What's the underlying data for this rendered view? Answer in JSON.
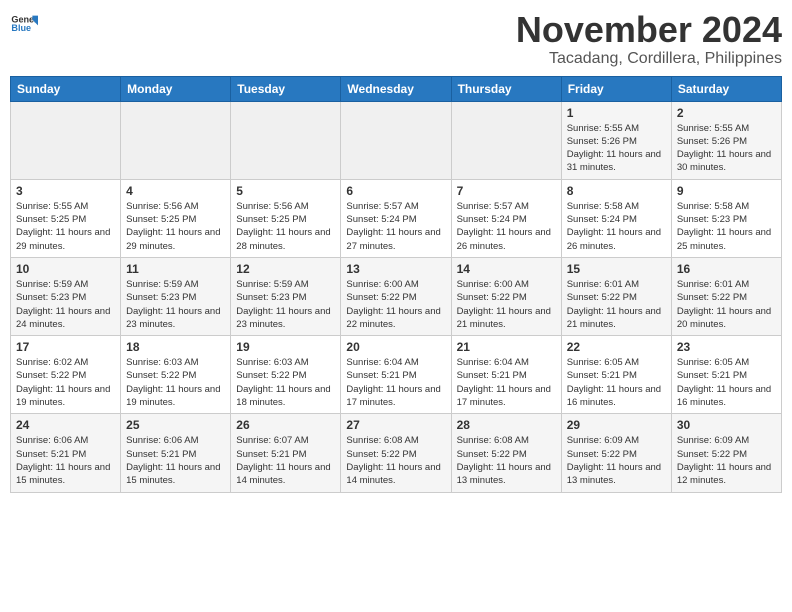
{
  "header": {
    "logo_line1": "General",
    "logo_line2": "Blue",
    "month": "November 2024",
    "location": "Tacadang, Cordillera, Philippines"
  },
  "weekdays": [
    "Sunday",
    "Monday",
    "Tuesday",
    "Wednesday",
    "Thursday",
    "Friday",
    "Saturday"
  ],
  "weeks": [
    [
      {
        "day": "",
        "info": ""
      },
      {
        "day": "",
        "info": ""
      },
      {
        "day": "",
        "info": ""
      },
      {
        "day": "",
        "info": ""
      },
      {
        "day": "",
        "info": ""
      },
      {
        "day": "1",
        "info": "Sunrise: 5:55 AM\nSunset: 5:26 PM\nDaylight: 11 hours and 31 minutes."
      },
      {
        "day": "2",
        "info": "Sunrise: 5:55 AM\nSunset: 5:26 PM\nDaylight: 11 hours and 30 minutes."
      }
    ],
    [
      {
        "day": "3",
        "info": "Sunrise: 5:55 AM\nSunset: 5:25 PM\nDaylight: 11 hours and 29 minutes."
      },
      {
        "day": "4",
        "info": "Sunrise: 5:56 AM\nSunset: 5:25 PM\nDaylight: 11 hours and 29 minutes."
      },
      {
        "day": "5",
        "info": "Sunrise: 5:56 AM\nSunset: 5:25 PM\nDaylight: 11 hours and 28 minutes."
      },
      {
        "day": "6",
        "info": "Sunrise: 5:57 AM\nSunset: 5:24 PM\nDaylight: 11 hours and 27 minutes."
      },
      {
        "day": "7",
        "info": "Sunrise: 5:57 AM\nSunset: 5:24 PM\nDaylight: 11 hours and 26 minutes."
      },
      {
        "day": "8",
        "info": "Sunrise: 5:58 AM\nSunset: 5:24 PM\nDaylight: 11 hours and 26 minutes."
      },
      {
        "day": "9",
        "info": "Sunrise: 5:58 AM\nSunset: 5:23 PM\nDaylight: 11 hours and 25 minutes."
      }
    ],
    [
      {
        "day": "10",
        "info": "Sunrise: 5:59 AM\nSunset: 5:23 PM\nDaylight: 11 hours and 24 minutes."
      },
      {
        "day": "11",
        "info": "Sunrise: 5:59 AM\nSunset: 5:23 PM\nDaylight: 11 hours and 23 minutes."
      },
      {
        "day": "12",
        "info": "Sunrise: 5:59 AM\nSunset: 5:23 PM\nDaylight: 11 hours and 23 minutes."
      },
      {
        "day": "13",
        "info": "Sunrise: 6:00 AM\nSunset: 5:22 PM\nDaylight: 11 hours and 22 minutes."
      },
      {
        "day": "14",
        "info": "Sunrise: 6:00 AM\nSunset: 5:22 PM\nDaylight: 11 hours and 21 minutes."
      },
      {
        "day": "15",
        "info": "Sunrise: 6:01 AM\nSunset: 5:22 PM\nDaylight: 11 hours and 21 minutes."
      },
      {
        "day": "16",
        "info": "Sunrise: 6:01 AM\nSunset: 5:22 PM\nDaylight: 11 hours and 20 minutes."
      }
    ],
    [
      {
        "day": "17",
        "info": "Sunrise: 6:02 AM\nSunset: 5:22 PM\nDaylight: 11 hours and 19 minutes."
      },
      {
        "day": "18",
        "info": "Sunrise: 6:03 AM\nSunset: 5:22 PM\nDaylight: 11 hours and 19 minutes."
      },
      {
        "day": "19",
        "info": "Sunrise: 6:03 AM\nSunset: 5:22 PM\nDaylight: 11 hours and 18 minutes."
      },
      {
        "day": "20",
        "info": "Sunrise: 6:04 AM\nSunset: 5:21 PM\nDaylight: 11 hours and 17 minutes."
      },
      {
        "day": "21",
        "info": "Sunrise: 6:04 AM\nSunset: 5:21 PM\nDaylight: 11 hours and 17 minutes."
      },
      {
        "day": "22",
        "info": "Sunrise: 6:05 AM\nSunset: 5:21 PM\nDaylight: 11 hours and 16 minutes."
      },
      {
        "day": "23",
        "info": "Sunrise: 6:05 AM\nSunset: 5:21 PM\nDaylight: 11 hours and 16 minutes."
      }
    ],
    [
      {
        "day": "24",
        "info": "Sunrise: 6:06 AM\nSunset: 5:21 PM\nDaylight: 11 hours and 15 minutes."
      },
      {
        "day": "25",
        "info": "Sunrise: 6:06 AM\nSunset: 5:21 PM\nDaylight: 11 hours and 15 minutes."
      },
      {
        "day": "26",
        "info": "Sunrise: 6:07 AM\nSunset: 5:21 PM\nDaylight: 11 hours and 14 minutes."
      },
      {
        "day": "27",
        "info": "Sunrise: 6:08 AM\nSunset: 5:22 PM\nDaylight: 11 hours and 14 minutes."
      },
      {
        "day": "28",
        "info": "Sunrise: 6:08 AM\nSunset: 5:22 PM\nDaylight: 11 hours and 13 minutes."
      },
      {
        "day": "29",
        "info": "Sunrise: 6:09 AM\nSunset: 5:22 PM\nDaylight: 11 hours and 13 minutes."
      },
      {
        "day": "30",
        "info": "Sunrise: 6:09 AM\nSunset: 5:22 PM\nDaylight: 11 hours and 12 minutes."
      }
    ]
  ]
}
